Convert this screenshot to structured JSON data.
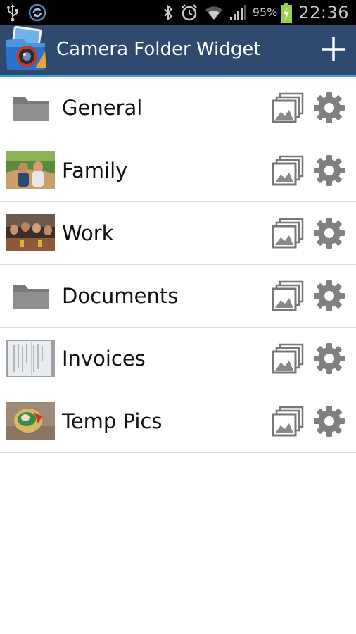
{
  "status_bar": {
    "battery_percent": "95%",
    "time": "22:36",
    "icons": [
      "usb-icon",
      "sync-icon",
      "bluetooth-icon",
      "alarm-icon",
      "wifi-icon",
      "signal-icon",
      "battery-charging-icon"
    ]
  },
  "app_bar": {
    "title": "Camera Folder Widget",
    "action_icon": "add-icon",
    "color": "#2f4a6f",
    "accent": "#3aa3d9"
  },
  "folders": [
    {
      "label": "General",
      "thumbnail": "folder-icon"
    },
    {
      "label": "Family",
      "thumbnail": "photo-thumbnail"
    },
    {
      "label": "Work",
      "thumbnail": "photo-thumbnail"
    },
    {
      "label": "Documents",
      "thumbnail": "folder-icon"
    },
    {
      "label": "Invoices",
      "thumbnail": "photo-thumbnail"
    },
    {
      "label": "Temp Pics",
      "thumbnail": "photo-thumbnail"
    }
  ]
}
